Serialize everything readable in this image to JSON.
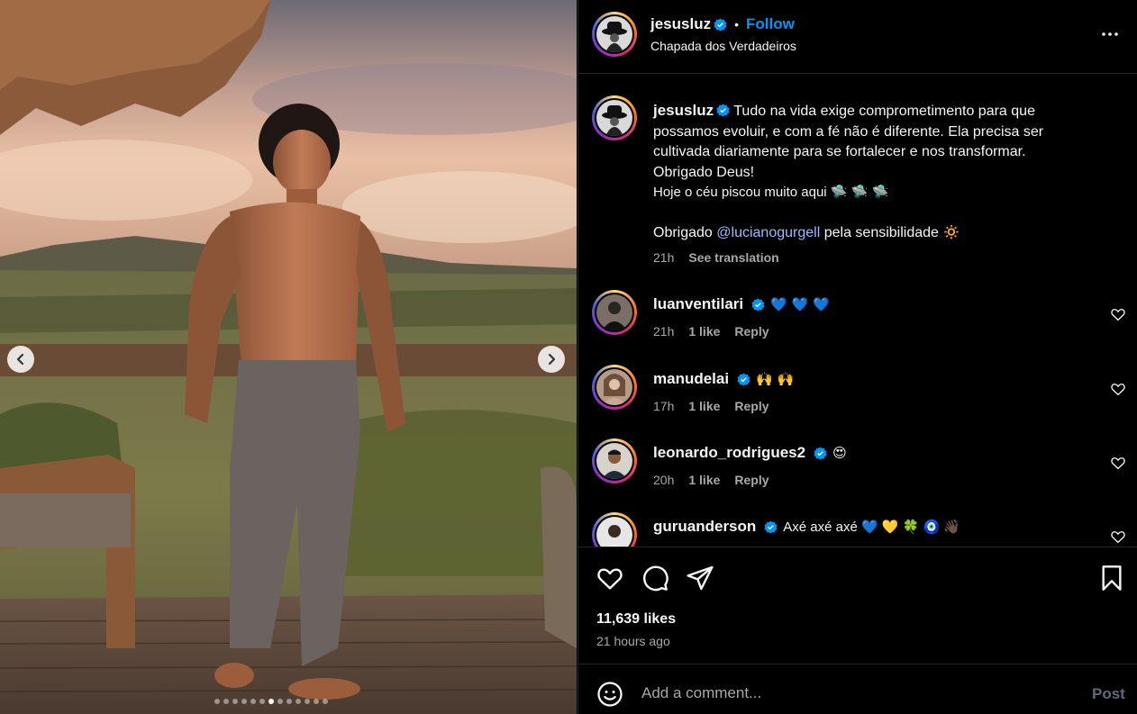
{
  "media": {
    "carousel_dots_total": 13,
    "carousel_dot_active_index": 6
  },
  "post": {
    "author": "jesusluz",
    "follow_label": "Follow",
    "separator": "•",
    "location": "Chapada dos Verdadeiros",
    "caption_lines": [
      "Tudo na vida exige comprometimento para que possamos evoluir, e com a fé não é diferente. Ela precisa ser cultivada diariamente para se fortalecer e nos transformar.",
      "Obrigado Deus!",
      "Hoje o céu piscou muito aqui 🛸 🛸 🛸"
    ],
    "thanks_prefix": "Obrigado",
    "thanks_mention": "@lucianogurgell",
    "thanks_suffix": "pela sensibilidade 🔅",
    "caption_time": "21h",
    "see_translation": "See translation",
    "likes": "11,639 likes",
    "time_ago": "21 hours ago"
  },
  "comments": [
    {
      "user": "luanventilari",
      "text": "💙 💙 💙",
      "time": "21h",
      "likes": "1 like",
      "reply": "Reply"
    },
    {
      "user": "manudelai",
      "text": "🙌 🙌",
      "time": "17h",
      "likes": "1 like",
      "reply": "Reply"
    },
    {
      "user": "leonardo_rodrigues2",
      "text": "😍",
      "time": "20h",
      "likes": "1 like",
      "reply": "Reply"
    },
    {
      "user": "guruanderson",
      "text": "Axé axé axé 💙 💛 🍀 🧿 👋🏿",
      "time": "",
      "likes": "",
      "reply": ""
    }
  ],
  "composer": {
    "placeholder": "Add a comment...",
    "post_label": "Post"
  },
  "colors": {
    "accent": "#0095f6",
    "mention": "#a0b6ff",
    "verified": "#0095f6"
  }
}
